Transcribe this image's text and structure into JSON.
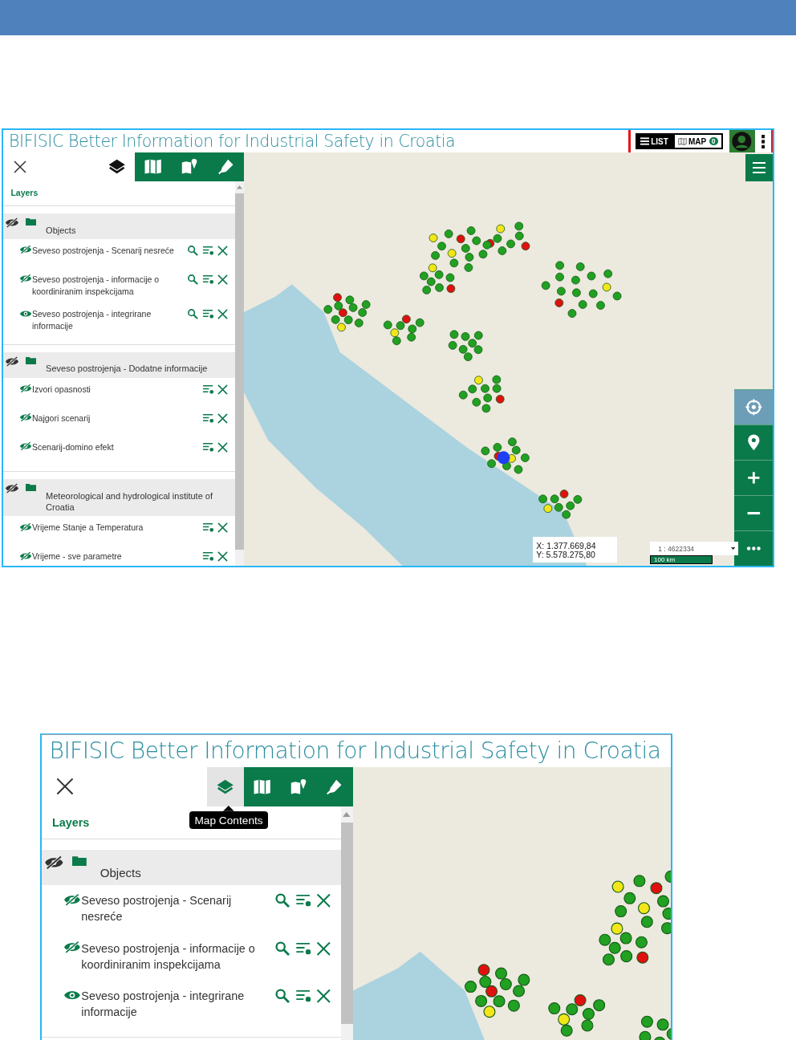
{
  "screenshots": [
    {
      "title": "BIFISIC Better Information for Industrial Safety in Croatia",
      "toolbar": {
        "highlighted": true,
        "list_label": "LIST",
        "map_label": "MAP",
        "map_count": "0"
      },
      "tabs": [
        {
          "kind": "layers",
          "selected": true,
          "hovered": false
        },
        {
          "kind": "map",
          "selected": false,
          "hovered": false
        },
        {
          "kind": "map-pin",
          "selected": false,
          "hovered": false
        },
        {
          "kind": "pen",
          "selected": false,
          "hovered": false
        }
      ],
      "panel_title": "Layers",
      "groups": [
        {
          "name": "Objects",
          "visible": false,
          "layers": [
            {
              "name": "Seveso postrojenja - Scenarij nesreće",
              "visible": false,
              "kind": "queryable"
            },
            {
              "name": "Seveso postrojenja - informacije o koordiniranim inspekcijama",
              "visible": false,
              "kind": "queryable"
            },
            {
              "name": "Seveso postrojenja - integrirane informacije",
              "visible": true,
              "kind": "queryable"
            }
          ]
        },
        {
          "name": "Seveso postrojenja - Dodatne informacije",
          "visible": false,
          "layers": [
            {
              "name": "Izvori opasnosti",
              "visible": false,
              "kind": "basic"
            },
            {
              "name": "Najgori scenarij",
              "visible": false,
              "kind": "basic"
            },
            {
              "name": "Scenarij-domino efekt",
              "visible": false,
              "kind": "basic"
            }
          ]
        },
        {
          "name": "Meteorological and hydrological institute of Croatia",
          "visible": false,
          "layers": [
            {
              "name": "Vrijeme Stanje a Temperatura",
              "visible": false,
              "kind": "basic"
            },
            {
              "name": "Vrijeme - sve parametre",
              "visible": false,
              "kind": "basic"
            }
          ]
        }
      ],
      "map_menu": true,
      "map_controls": [
        {
          "kind": "locate"
        },
        {
          "kind": "pin"
        },
        {
          "kind": "zoom-in"
        },
        {
          "kind": "zoom-out"
        },
        {
          "kind": "more"
        }
      ],
      "coordinates": {
        "x": "X: 1.377.669,84",
        "y": "Y: 5.578.275,80"
      },
      "scale": {
        "value": "1 : 4622334",
        "bar": "100 km"
      }
    },
    {
      "title": "BIFISIC Better Information for Industrial Safety in Croatia",
      "tabs": [
        {
          "kind": "layers",
          "selected": true,
          "hovered": true
        },
        {
          "kind": "map",
          "selected": false,
          "hovered": false
        },
        {
          "kind": "map-pin",
          "selected": false,
          "hovered": false
        },
        {
          "kind": "pen",
          "selected": false,
          "hovered": false
        }
      ],
      "tooltip": "Map Contents",
      "panel_title": "Layers",
      "groups": [
        {
          "name": "Objects",
          "visible": false,
          "layers": [
            {
              "name": "Seveso postrojenja - Scenarij nesreće",
              "visible": false,
              "kind": "queryable"
            },
            {
              "name": "Seveso postrojenja - informacije o koordiniranim inspekcijama",
              "visible": false,
              "kind": "queryable"
            },
            {
              "name": "Seveso postrojenja - integrirane informacije",
              "visible": true,
              "kind": "queryable"
            }
          ]
        }
      ]
    }
  ]
}
